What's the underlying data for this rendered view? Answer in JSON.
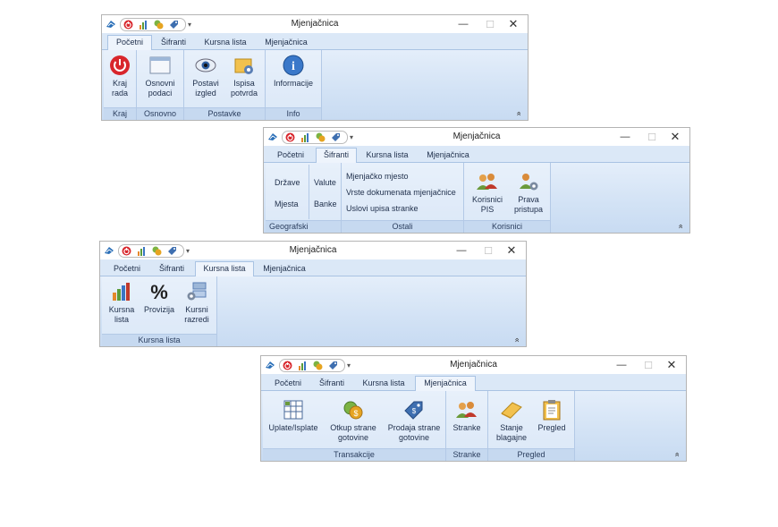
{
  "app_title": "Mjenjačnica",
  "qat_icons": [
    "exit-icon",
    "chart-icon",
    "coins-icon",
    "tag-icon"
  ],
  "tabs": [
    "Početni",
    "Šifranti",
    "Kursna lista",
    "Mjenjačnica"
  ],
  "window1": {
    "active_tab": "Početni",
    "groups": {
      "kraj": {
        "label": "Kraj",
        "btn": "Kraj rada"
      },
      "osnovno": {
        "label": "Osnovno",
        "btn": "Osnovni podaci"
      },
      "postavke": {
        "label": "Postavke",
        "btn1": "Postavi izgled",
        "btn2": "Ispisa potvrda"
      },
      "info": {
        "label": "Info",
        "btn": "Informacije"
      }
    }
  },
  "window2": {
    "active_tab": "Šifranti",
    "groups": {
      "geografski": {
        "label": "Geografski",
        "items": [
          "Države",
          "Mjesta",
          "Valute",
          "Banke"
        ]
      },
      "ostali": {
        "label": "Ostali",
        "items": [
          "Mjenjačko mjesto",
          "Vrste dokumenata mjenjačnice",
          "Uslovi upisa stranke"
        ]
      },
      "korisnici": {
        "label": "Korisnici",
        "btn1": "Korisnici PIS",
        "btn2": "Prava pristupa"
      }
    }
  },
  "window3": {
    "active_tab": "Kursna lista",
    "groups": {
      "kursna": {
        "label": "Kursna lista",
        "btn1": "Kursna lista",
        "btn2": "Provizija",
        "btn3": "Kursni razredi"
      }
    }
  },
  "window4": {
    "active_tab": "Mjenjačnica",
    "groups": {
      "transakcije": {
        "label": "Transakcije",
        "btn1": "Uplate/Isplate",
        "btn2": "Otkup strane gotovine",
        "btn3": "Prodaja strane gotovine"
      },
      "stranke": {
        "label": "Stranke",
        "btn": "Stranke"
      },
      "pregled": {
        "label": "Pregled",
        "btn1": "Stanje blagajne",
        "btn2": "Pregled"
      }
    }
  },
  "window_controls": {
    "minimize": "—",
    "maximize": "☐",
    "close": "✕"
  },
  "collapse_symbol": "»",
  "percent_symbol": "%"
}
